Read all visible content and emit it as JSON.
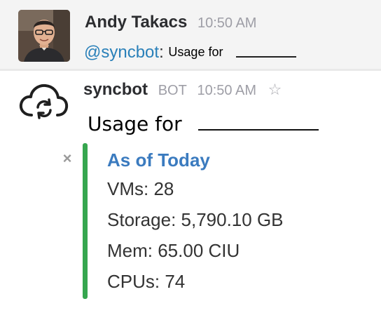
{
  "message_user": {
    "sender": "Andy Takacs",
    "time": "10:50 AM",
    "mention": "@syncbot",
    "colon": ":",
    "text": "Usage for"
  },
  "message_bot": {
    "name": "syncbot",
    "tag": "BOT",
    "time": "10:50 AM",
    "star_icon": "star-icon",
    "usage_title": "Usage for",
    "attachment": {
      "color": "#36a64f",
      "title": "As of Today",
      "lines": [
        "VMs: 28",
        "Storage: 5,790.10 GB",
        "Mem: 65.00 CIU",
        "CPUs: 74"
      ],
      "dismiss_icon": "close-icon"
    }
  },
  "colors": {
    "mention": "#2a80b9",
    "attachment_title": "#3b7bbf",
    "highlight_bg": "#f4f4f4"
  }
}
